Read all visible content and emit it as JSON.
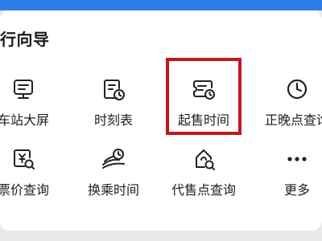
{
  "header": {
    "title": "行向导",
    "bar_color": "#2f7de8"
  },
  "grid": {
    "items": [
      {
        "label": "车站大屏",
        "icon": "station-screen-icon"
      },
      {
        "label": "时刻表",
        "icon": "timetable-icon"
      },
      {
        "label": "起售时间",
        "icon": "ticket-sale-time-icon"
      },
      {
        "label": "正晚点查询",
        "icon": "clock-icon"
      },
      {
        "label": "票价查询",
        "icon": "fare-search-icon"
      },
      {
        "label": "换乘时间",
        "icon": "transfer-time-icon"
      },
      {
        "label": "代售点查询",
        "icon": "agency-search-icon"
      },
      {
        "label": "更多",
        "icon": "more-dots-icon"
      }
    ]
  },
  "highlight_color": "#c4161c"
}
